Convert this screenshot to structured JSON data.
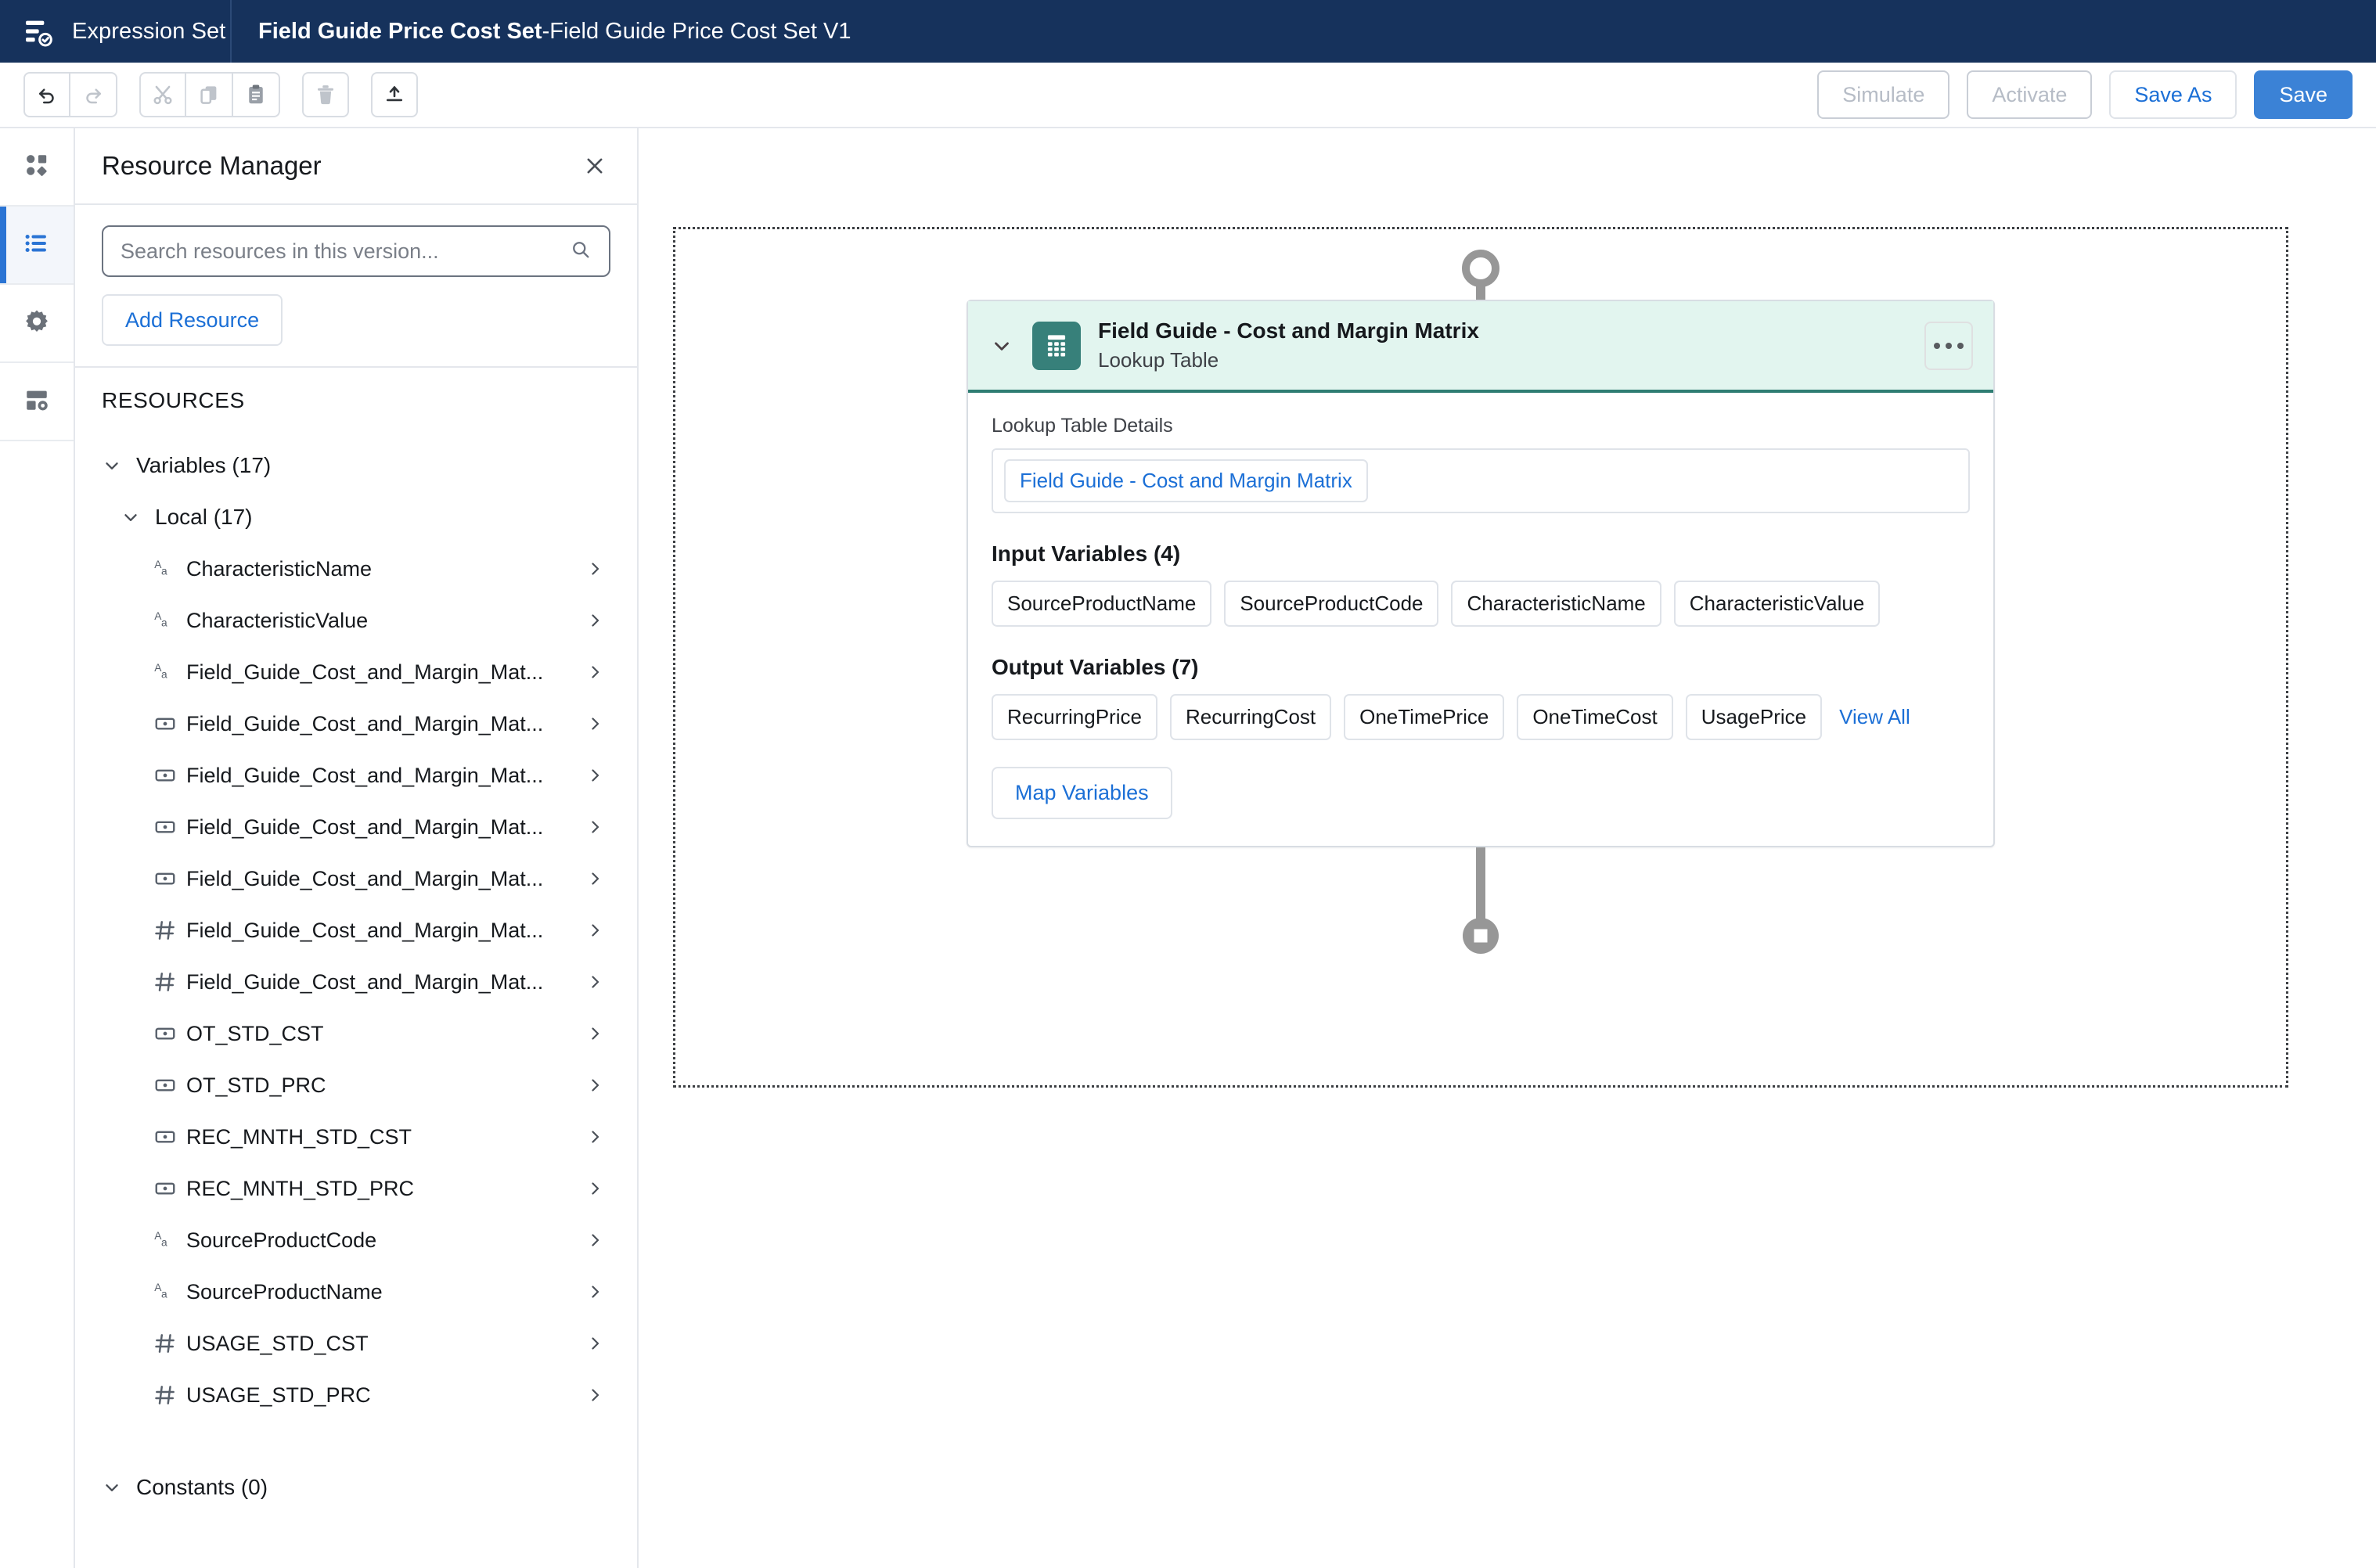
{
  "topbar": {
    "brand_icon": "expression-set-icon",
    "brand_label": "Expression Set",
    "title_main": "Field Guide Price Cost Set",
    "title_sep": " - ",
    "title_version": "Field Guide Price Cost Set V1",
    "bg_color": "#16325c"
  },
  "actionbar": {
    "tools": [
      {
        "name": "undo-icon",
        "enabled": true
      },
      {
        "name": "redo-icon",
        "enabled": false
      },
      {
        "name": "cut-icon",
        "enabled": false
      },
      {
        "name": "copy-icon",
        "enabled": false
      },
      {
        "name": "paste-icon",
        "enabled": true
      },
      {
        "name": "delete-icon",
        "enabled": false
      },
      {
        "name": "insert-icon",
        "enabled": true
      }
    ],
    "simulate_label": "Simulate",
    "activate_label": "Activate",
    "save_as_label": "Save As",
    "save_label": "Save",
    "primary_color": "#3b82d6",
    "link_color": "#1b6fd6"
  },
  "rail": {
    "items": [
      {
        "icon": "components-icon",
        "active": false
      },
      {
        "icon": "list-icon",
        "active": true
      },
      {
        "icon": "gear-icon",
        "active": false
      },
      {
        "icon": "card-settings-icon",
        "active": false
      }
    ],
    "active_color": "#2a74d4"
  },
  "panel": {
    "title": "Resource Manager",
    "close_icon": "close-icon",
    "search": {
      "placeholder": "Search resources in this version...",
      "value": "",
      "icon": "search-icon"
    },
    "add_resource_label": "Add Resource",
    "section_label": "RESOURCES",
    "groups": [
      {
        "label": "Variables (17)",
        "level": 0,
        "expanded": true
      },
      {
        "label": "Local (17)",
        "level": 1,
        "expanded": true
      }
    ],
    "variables": [
      {
        "name": "CharacteristicName",
        "type": "text"
      },
      {
        "name": "CharacteristicValue",
        "type": "text"
      },
      {
        "name": "Field_Guide_Cost_and_Margin_Mat...",
        "type": "text"
      },
      {
        "name": "Field_Guide_Cost_and_Margin_Mat...",
        "type": "currency"
      },
      {
        "name": "Field_Guide_Cost_and_Margin_Mat...",
        "type": "currency"
      },
      {
        "name": "Field_Guide_Cost_and_Margin_Mat...",
        "type": "currency"
      },
      {
        "name": "Field_Guide_Cost_and_Margin_Mat...",
        "type": "currency"
      },
      {
        "name": "Field_Guide_Cost_and_Margin_Mat...",
        "type": "number"
      },
      {
        "name": "Field_Guide_Cost_and_Margin_Mat...",
        "type": "number"
      },
      {
        "name": "OT_STD_CST",
        "type": "currency"
      },
      {
        "name": "OT_STD_PRC",
        "type": "currency"
      },
      {
        "name": "REC_MNTH_STD_CST",
        "type": "currency"
      },
      {
        "name": "REC_MNTH_STD_PRC",
        "type": "currency"
      },
      {
        "name": "SourceProductCode",
        "type": "text"
      },
      {
        "name": "SourceProductName",
        "type": "text"
      },
      {
        "name": "USAGE_STD_CST",
        "type": "number"
      },
      {
        "name": "USAGE_STD_PRC",
        "type": "number"
      }
    ],
    "constants_label": "Constants (0)"
  },
  "canvas": {
    "start_node": "start-node",
    "end_node": "end-node",
    "node": {
      "title": "Field Guide - Cost and Margin Matrix",
      "subtitle": "Lookup Table",
      "type_icon": "lookup-table-icon",
      "menu_icon": "more-options-icon",
      "collapse_icon": "chevron-down-icon",
      "header_bg": "#e2f5ef",
      "accent_color": "#2e7d72",
      "details_label": "Lookup Table Details",
      "details_value": "Field Guide - Cost and Margin Matrix",
      "input_section_title": "Input Variables (4)",
      "input_variables": [
        "SourceProductName",
        "SourceProductCode",
        "CharacteristicName",
        "CharacteristicValue"
      ],
      "output_section_title": "Output Variables (7)",
      "output_variables": [
        "RecurringPrice",
        "RecurringCost",
        "OneTimePrice",
        "OneTimeCost",
        "UsagePrice"
      ],
      "view_all_label": "View All",
      "map_variables_label": "Map Variables"
    }
  }
}
